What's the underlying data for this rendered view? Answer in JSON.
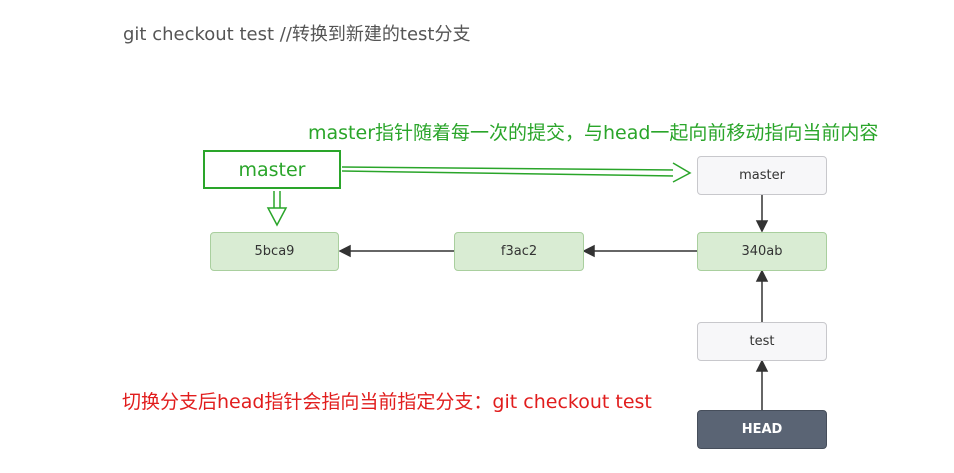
{
  "header": {
    "title": "git checkout test //转换到新建的test分支"
  },
  "annotations": {
    "green_note": "master指针随着每一次的提交，与head一起向前移动指向当前内容",
    "red_note": "切换分支后head指针会指向当前指定分支：git checkout test",
    "master_label": "master"
  },
  "diagram": {
    "commits": [
      "5bca9",
      "f3ac2",
      "340ab"
    ],
    "branch_master": "master",
    "branch_test": "test",
    "head": "HEAD"
  },
  "colors": {
    "annotation_green": "#2aa52a",
    "annotation_red": "#e11d1d",
    "commit_fill": "#d9ecd3",
    "ref_fill": "#f7f7f9",
    "head_fill": "#5a6474"
  }
}
